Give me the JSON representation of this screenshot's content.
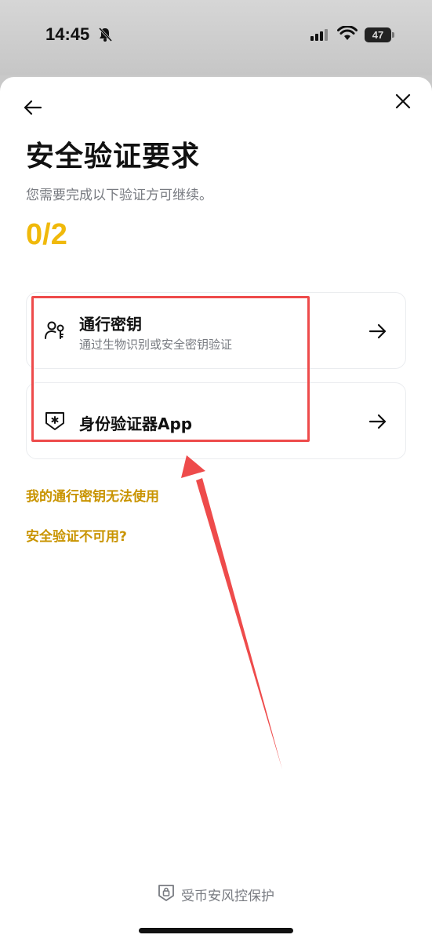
{
  "status_bar": {
    "time": "14:45",
    "battery": "47",
    "icons": [
      "bell-slash-icon",
      "cellular-signal-icon",
      "wifi-icon",
      "battery-icon"
    ]
  },
  "header": {
    "back_icon": "arrow-left-icon",
    "close_icon": "close-icon"
  },
  "title": "安全验证要求",
  "subtitle": "您需要完成以下验证方可继续。",
  "progress": "0/2",
  "options": [
    {
      "title": "通行密钥",
      "description": "通过生物识别或安全密钥验证",
      "icon": "passkey-person-key-icon",
      "arrow_icon": "arrow-right-icon"
    },
    {
      "title": "身份验证器App",
      "description": "",
      "icon": "authenticator-shield-icon",
      "arrow_icon": "arrow-right-icon"
    }
  ],
  "links": {
    "passkey_unavailable": "我的通行密钥无法使用",
    "verification_unavailable": "安全验证不可用?"
  },
  "footer": {
    "label": "受币安风控保护",
    "icon": "shield-lock-icon"
  },
  "colors": {
    "accent": "#F0B90B",
    "link": "#C99400",
    "annotation": "#EE4B4B"
  }
}
